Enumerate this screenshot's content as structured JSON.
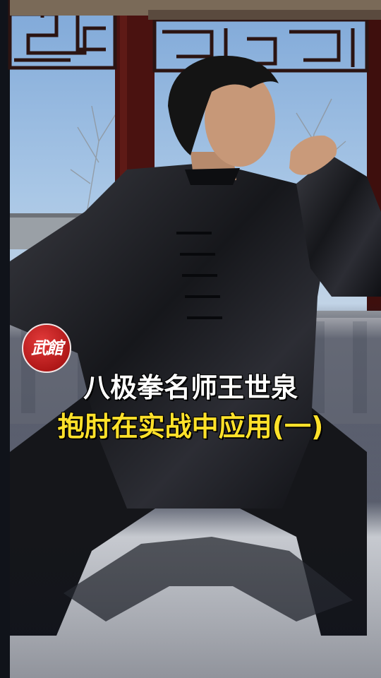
{
  "caption": {
    "line1": "八极拳名师王世泉",
    "line2": "抱肘在实战中应用(一)"
  },
  "logo": {
    "text": "武館"
  },
  "colors": {
    "caption_primary": "#ffffff",
    "caption_highlight": "#ffe12a",
    "logo_red": "#c41e1e",
    "sky": "#9fc2e6",
    "uniform": "#1d1e22"
  }
}
